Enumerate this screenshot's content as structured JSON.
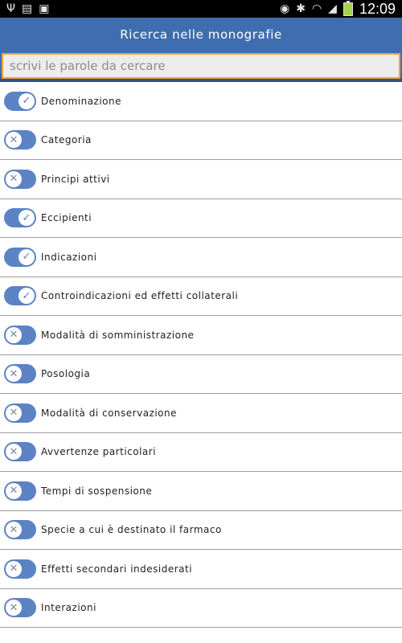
{
  "status_bar": {
    "time": "12:09"
  },
  "header": {
    "title": "Ricerca nelle monografie"
  },
  "search": {
    "placeholder": "scrivi le parole da cercare",
    "value": ""
  },
  "items": [
    {
      "label": "Denominazione",
      "on": true
    },
    {
      "label": "Categoria",
      "on": false
    },
    {
      "label": "Principi attivi",
      "on": false
    },
    {
      "label": "Eccipienti",
      "on": true
    },
    {
      "label": "Indicazioni",
      "on": true
    },
    {
      "label": "Controindicazioni ed effetti collaterali",
      "on": true
    },
    {
      "label": "Modalità di somministrazione",
      "on": false
    },
    {
      "label": "Posologia",
      "on": false
    },
    {
      "label": "Modalità di conservazione",
      "on": false
    },
    {
      "label": "Avvertenze particolari",
      "on": false
    },
    {
      "label": "Tempi di sospensione",
      "on": false
    },
    {
      "label": "Specie a cui è destinato il farmaco",
      "on": false
    },
    {
      "label": "Effetti secondari indesiderati",
      "on": false
    },
    {
      "label": "Interazioni",
      "on": false
    }
  ]
}
